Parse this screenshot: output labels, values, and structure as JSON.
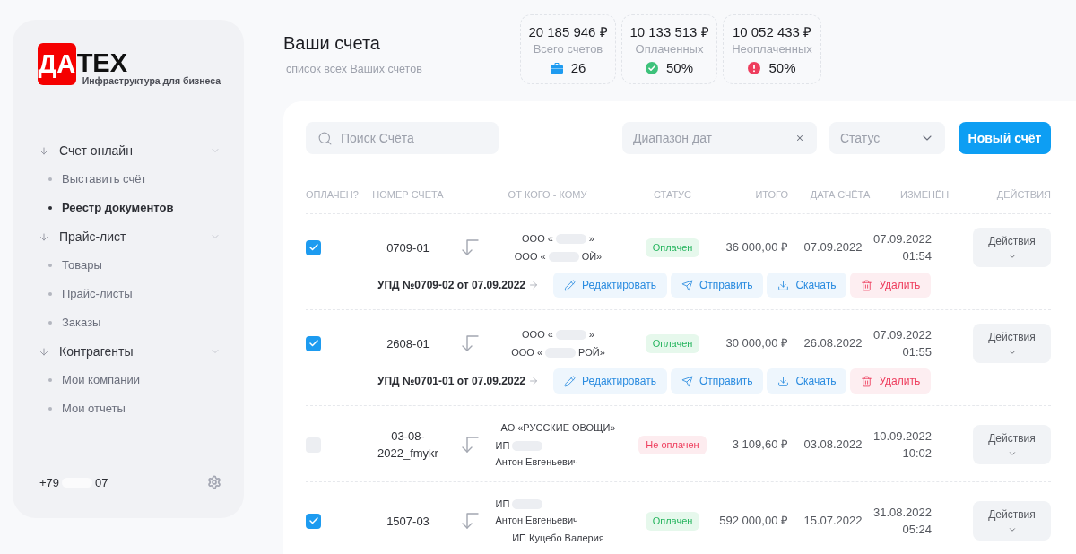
{
  "sidebar": {
    "logo": {
      "mark": "ДА",
      "text": "ТЕХ",
      "tagline": "Инфраструктура для бизнеса"
    },
    "sections": [
      {
        "label": "Счет онлайн",
        "expanded": true,
        "items": [
          {
            "label": "Выставить счёт",
            "selected": false
          },
          {
            "label": "Реестр документов",
            "selected": true
          }
        ]
      },
      {
        "label": "Прайс-лист",
        "expanded": true,
        "items": [
          {
            "label": "Товары",
            "selected": false
          },
          {
            "label": "Прайс-листы",
            "selected": false
          },
          {
            "label": "Заказы",
            "selected": false
          }
        ]
      },
      {
        "label": "Контрагенты",
        "expanded": true,
        "items": [
          {
            "label": "Мои компании",
            "selected": false
          },
          {
            "label": "Мои отчеты",
            "selected": false
          }
        ]
      }
    ],
    "phone_parts": [
      "+79",
      "07"
    ]
  },
  "header": {
    "title": "Ваши счета",
    "subtitle": "список всех Ваших счетов"
  },
  "stats": [
    {
      "kind": "total",
      "amount": "20 185 946 ₽",
      "label": "Всего счетов",
      "value": "26"
    },
    {
      "kind": "paid",
      "amount": "10 133 513 ₽",
      "label": "Оплаченных",
      "value": "50%"
    },
    {
      "kind": "unpaid",
      "amount": "10 052 433 ₽",
      "label": "Неоплаченных",
      "value": "50%"
    }
  ],
  "filters": {
    "search": {
      "placeholder": "Поиск Счёта"
    },
    "date_range": {
      "placeholder": "Диапазон дат"
    },
    "status": {
      "placeholder": "Статус"
    },
    "new_button": "Новый счёт"
  },
  "table": {
    "columns": [
      "ОПЛАЧЕН?",
      "НОМЕР СЧЕТА",
      "ОТ КОГО - КОМУ",
      "СТАТУС",
      "ИТОГО",
      "ДАТА СЧЁТА",
      "ИЗМЕНЁН",
      "ДЕЙСТВИЯ"
    ],
    "rows": [
      {
        "paid": true,
        "number": "0709-01",
        "parties": [
          {
            "parts": [
              "ООО «",
              "»"
            ]
          },
          {
            "parts": [
              "ООО «",
              "ОЙ»"
            ]
          }
        ],
        "status": {
          "kind": "paid",
          "label": "Оплачен"
        },
        "total": "36 000,00 ₽",
        "date": "07.09.2022",
        "changed_date": "07.09.2022",
        "changed_time": "01:54",
        "actions": "Действия",
        "document": "УПД №0709-02 от 07.09.2022",
        "buttons": [
          {
            "kind": "edit",
            "label": "Редактировать"
          },
          {
            "kind": "send",
            "label": "Отправить"
          },
          {
            "kind": "download",
            "label": "Скачать"
          },
          {
            "kind": "delete",
            "label": "Удалить"
          }
        ]
      },
      {
        "paid": true,
        "number": "2608-01",
        "parties": [
          {
            "parts": [
              "ООО «",
              "»"
            ]
          },
          {
            "parts": [
              "ООО «",
              "РОЙ»"
            ]
          }
        ],
        "status": {
          "kind": "paid",
          "label": "Оплачен"
        },
        "total": "30 000,00 ₽",
        "date": "26.08.2022",
        "changed_date": "07.09.2022",
        "changed_time": "01:55",
        "actions": "Действия",
        "document": "УПД №0701-01 от 07.09.2022",
        "buttons": [
          {
            "kind": "edit",
            "label": "Редактировать"
          },
          {
            "kind": "send",
            "label": "Отправить"
          },
          {
            "kind": "download",
            "label": "Скачать"
          },
          {
            "kind": "delete",
            "label": "Удалить"
          }
        ]
      },
      {
        "paid": false,
        "number": "03-08-2022_fmykr",
        "parties": [
          {
            "parts": [
              "АО «РУССКИЕ ОВОЩИ»"
            ]
          },
          {
            "parts": [
              "ИП",
              "Антон Евгеньевич"
            ]
          }
        ],
        "status": {
          "kind": "unpaid",
          "label": "Не оплачен"
        },
        "total": "3 109,60 ₽",
        "date": "03.08.2022",
        "changed_date": "10.09.2022",
        "changed_time": "10:02",
        "actions": "Действия"
      },
      {
        "paid": true,
        "number": "1507-03",
        "parties": [
          {
            "parts": [
              "ИП",
              "Антон Евгеньевич"
            ]
          },
          {
            "parts": [
              "ИП Куцебо Валерия"
            ]
          }
        ],
        "status": {
          "kind": "paid",
          "label": "Оплачен"
        },
        "total": "592 000,00 ₽",
        "date": "15.07.2022",
        "changed_date": "31.08.2022",
        "changed_time": "05:24",
        "actions": "Действия"
      }
    ]
  }
}
